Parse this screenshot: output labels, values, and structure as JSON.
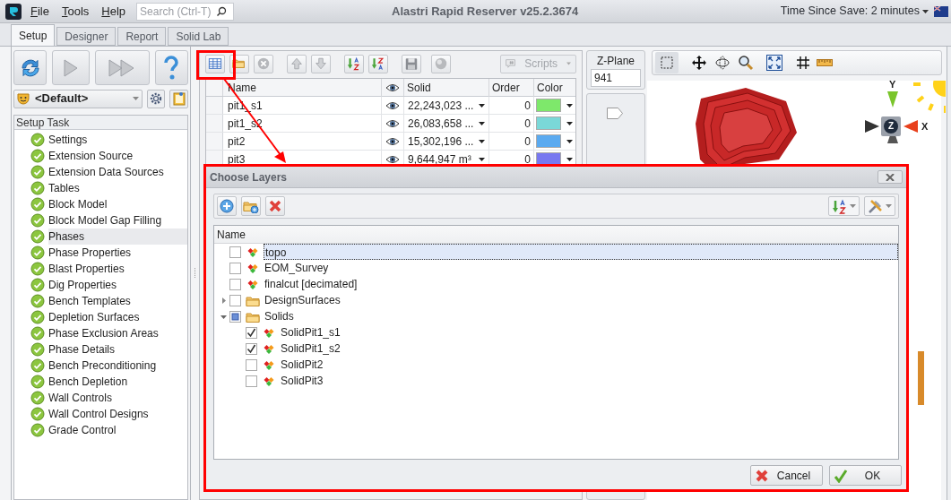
{
  "app": {
    "menu": [
      "File",
      "Tools",
      "Help"
    ],
    "search": {
      "placeholder": "Search (Ctrl-T)"
    },
    "title": "Alastri Rapid Reserver v25.2.3674",
    "save_status": "Time Since Save: 2 minutes"
  },
  "tabs": [
    {
      "label": "Setup",
      "selected": true
    },
    {
      "label": "Designer",
      "selected": false
    },
    {
      "label": "Report",
      "selected": false
    },
    {
      "label": "Solid Lab",
      "selected": false
    }
  ],
  "profile": {
    "value": "<Default>"
  },
  "setup_task": {
    "header": "Setup Task",
    "items": [
      {
        "label": "Settings",
        "selected": false
      },
      {
        "label": "Extension Source",
        "selected": false
      },
      {
        "label": "Extension Data Sources",
        "selected": false
      },
      {
        "label": "Tables",
        "selected": false
      },
      {
        "label": "Block Model",
        "selected": false
      },
      {
        "label": "Block Model Gap Filling",
        "selected": false
      },
      {
        "label": "Phases",
        "selected": true
      },
      {
        "label": "Phase Properties",
        "selected": false
      },
      {
        "label": "Blast Properties",
        "selected": false
      },
      {
        "label": "Dig Properties",
        "selected": false
      },
      {
        "label": "Bench Templates",
        "selected": false
      },
      {
        "label": "Depletion Surfaces",
        "selected": false
      },
      {
        "label": "Phase Exclusion Areas",
        "selected": false
      },
      {
        "label": "Phase Details",
        "selected": false
      },
      {
        "label": "Bench Preconditioning",
        "selected": false
      },
      {
        "label": "Bench Depletion",
        "selected": false
      },
      {
        "label": "Wall Controls",
        "selected": false
      },
      {
        "label": "Wall Control Designs",
        "selected": false
      },
      {
        "label": "Grade Control",
        "selected": false
      }
    ]
  },
  "layers_toolbar": {
    "scripts_label": "Scripts"
  },
  "layers_table": {
    "columns": [
      "Name",
      "Solid",
      "Order",
      "Color"
    ],
    "rows": [
      {
        "name": "pit1_s1",
        "solid": "22,243,023 ...",
        "order": "0",
        "color": "#7ee86b"
      },
      {
        "name": "pit1_s2",
        "solid": "26,083,658 ...",
        "order": "0",
        "color": "#7ad8d8"
      },
      {
        "name": "pit2",
        "solid": "15,302,196 ...",
        "order": "0",
        "color": "#5aaaf0"
      },
      {
        "name": "pit3",
        "solid": "9,644,947 m³",
        "order": "0",
        "color": "#7878f0"
      }
    ]
  },
  "z_plane": {
    "label": "Z-Plane",
    "value": "941",
    "level": 0.97
  },
  "viewport": {
    "axis_labels": {
      "y": "Y",
      "z": "Z",
      "x": "X"
    }
  },
  "dialog": {
    "title": "Choose Layers",
    "column": "Name",
    "layers": [
      {
        "label": "topo",
        "kind": "layer",
        "checked": false,
        "indeterminate": false,
        "selected": true
      },
      {
        "label": "EOM_Survey",
        "kind": "layer",
        "checked": false,
        "indeterminate": false,
        "selected": false
      },
      {
        "label": "finalcut [decimated]",
        "kind": "layer",
        "checked": false,
        "indeterminate": false,
        "selected": false
      },
      {
        "label": "DesignSurfaces",
        "kind": "folder",
        "checked": false,
        "indeterminate": false,
        "selected": false,
        "expanded": false
      },
      {
        "label": "Solids",
        "kind": "folder",
        "checked": false,
        "indeterminate": true,
        "selected": false,
        "expanded": true,
        "children": [
          {
            "label": "SolidPit1_s1",
            "kind": "layer",
            "checked": true,
            "indeterminate": false,
            "selected": false
          },
          {
            "label": "SolidPit1_s2",
            "kind": "layer",
            "checked": true,
            "indeterminate": false,
            "selected": false
          },
          {
            "label": "SolidPit2",
            "kind": "layer",
            "checked": false,
            "indeterminate": false,
            "selected": false
          },
          {
            "label": "SolidPit3",
            "kind": "layer",
            "checked": false,
            "indeterminate": false,
            "selected": false
          }
        ]
      }
    ],
    "buttons": [
      {
        "kind": "cancel",
        "label": "Cancel"
      },
      {
        "kind": "ok",
        "label": "OK"
      }
    ]
  }
}
